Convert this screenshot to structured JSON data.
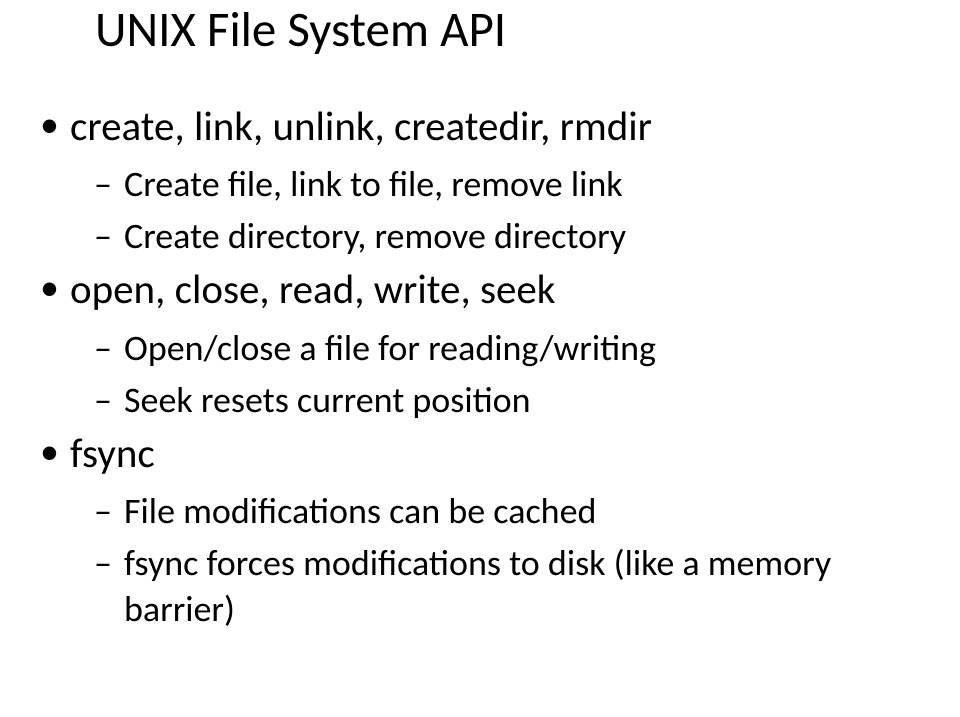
{
  "title": "UNIX File System API",
  "bullets": {
    "b1": "create, link, unlink, createdir, rmdir",
    "b1_1": "Create file, link to file, remove link",
    "b1_2": "Create directory, remove directory",
    "b2": "open, close, read, write, seek",
    "b2_1": "Open/close a file for reading/writing",
    "b2_2": "Seek resets current position",
    "b3": "fsync",
    "b3_1": "File modifications can be cached",
    "b3_2": "fsync forces modifications to disk (like a memory barrier)"
  }
}
